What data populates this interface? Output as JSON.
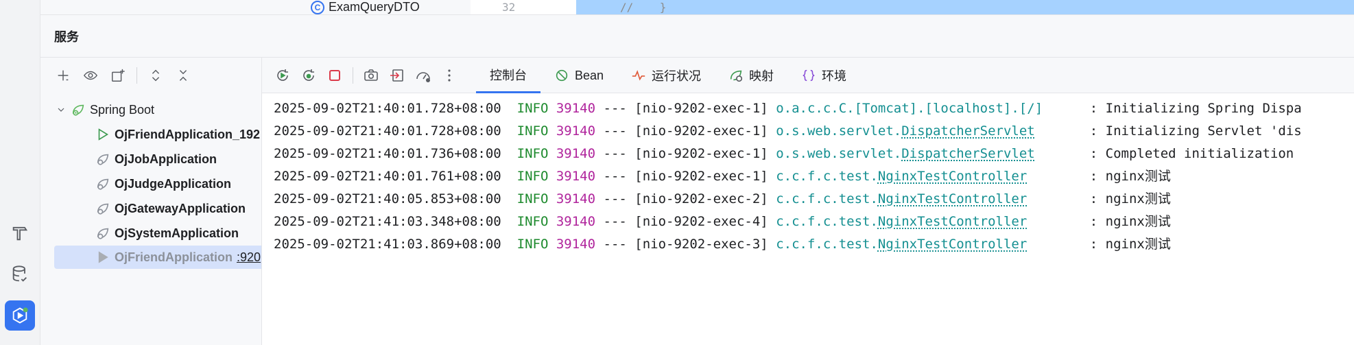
{
  "window": {
    "top_tree_item": "ExamQueryDTO",
    "gutter_line_number": "32",
    "selected_code": "//    }"
  },
  "panel": {
    "title": "服务"
  },
  "tree": {
    "root": "Spring Boot",
    "items": [
      {
        "label": "OjFriendApplication_192",
        "port": "",
        "state": "running"
      },
      {
        "label": "OjJobApplication",
        "port": "",
        "state": "stopped"
      },
      {
        "label": "OjJudgeApplication",
        "port": "",
        "state": "stopped"
      },
      {
        "label": "OjGatewayApplication",
        "port": "",
        "state": "stopped"
      },
      {
        "label": "OjSystemApplication",
        "port": "",
        "state": "stopped"
      },
      {
        "label": "OjFriendApplication",
        "port": ":920",
        "state": "selected"
      }
    ]
  },
  "console": {
    "tabs": [
      {
        "label": "控制台",
        "icon": "console-icon"
      },
      {
        "label": "Bean",
        "icon": "bean-icon"
      },
      {
        "label": "运行状况",
        "icon": "health-icon"
      },
      {
        "label": "映射",
        "icon": "mapping-icon"
      },
      {
        "label": "环境",
        "icon": "environment-icon"
      }
    ],
    "lines": [
      {
        "ts": "2025-09-02T21:40:01.728+08:00",
        "level": "INFO",
        "pid": "39140",
        "sep": "---",
        "thread": "[nio-9202-exec-1]",
        "logger_pkg": "o.a.c.c.C.[Tomcat].[localhost].[/]",
        "logger_cls": "",
        "pad": "      ",
        "msg": ": Initializing Spring Dispa"
      },
      {
        "ts": "2025-09-02T21:40:01.728+08:00",
        "level": "INFO",
        "pid": "39140",
        "sep": "---",
        "thread": "[nio-9202-exec-1]",
        "logger_pkg": "o.s.web.servlet.",
        "logger_cls": "DispatcherServlet",
        "pad": "       ",
        "msg": ": Initializing Servlet 'dis"
      },
      {
        "ts": "2025-09-02T21:40:01.736+08:00",
        "level": "INFO",
        "pid": "39140",
        "sep": "---",
        "thread": "[nio-9202-exec-1]",
        "logger_pkg": "o.s.web.servlet.",
        "logger_cls": "DispatcherServlet",
        "pad": "       ",
        "msg": ": Completed initialization"
      },
      {
        "ts": "2025-09-02T21:40:01.761+08:00",
        "level": "INFO",
        "pid": "39140",
        "sep": "---",
        "thread": "[nio-9202-exec-1]",
        "logger_pkg": "c.c.f.c.test.",
        "logger_cls": "NginxTestController",
        "pad": "        ",
        "msg": ": nginx测试"
      },
      {
        "ts": "2025-09-02T21:40:05.853+08:00",
        "level": "INFO",
        "pid": "39140",
        "sep": "---",
        "thread": "[nio-9202-exec-2]",
        "logger_pkg": "c.c.f.c.test.",
        "logger_cls": "NginxTestController",
        "pad": "        ",
        "msg": ": nginx测试"
      },
      {
        "ts": "2025-09-02T21:41:03.348+08:00",
        "level": "INFO",
        "pid": "39140",
        "sep": "---",
        "thread": "[nio-9202-exec-4]",
        "logger_pkg": "c.c.f.c.test.",
        "logger_cls": "NginxTestController",
        "pad": "        ",
        "msg": ": nginx测试"
      },
      {
        "ts": "2025-09-02T21:41:03.869+08:00",
        "level": "INFO",
        "pid": "39140",
        "sep": "---",
        "thread": "[nio-9202-exec-3]",
        "logger_pkg": "c.c.f.c.test.",
        "logger_cls": "NginxTestController",
        "pad": "        ",
        "msg": ": nginx测试"
      }
    ]
  },
  "colors": {
    "accent": "#3574f0",
    "info": "#1d8a2d",
    "pid": "#b0249c",
    "logger": "#148f91",
    "selection": "#a6d2ff"
  }
}
